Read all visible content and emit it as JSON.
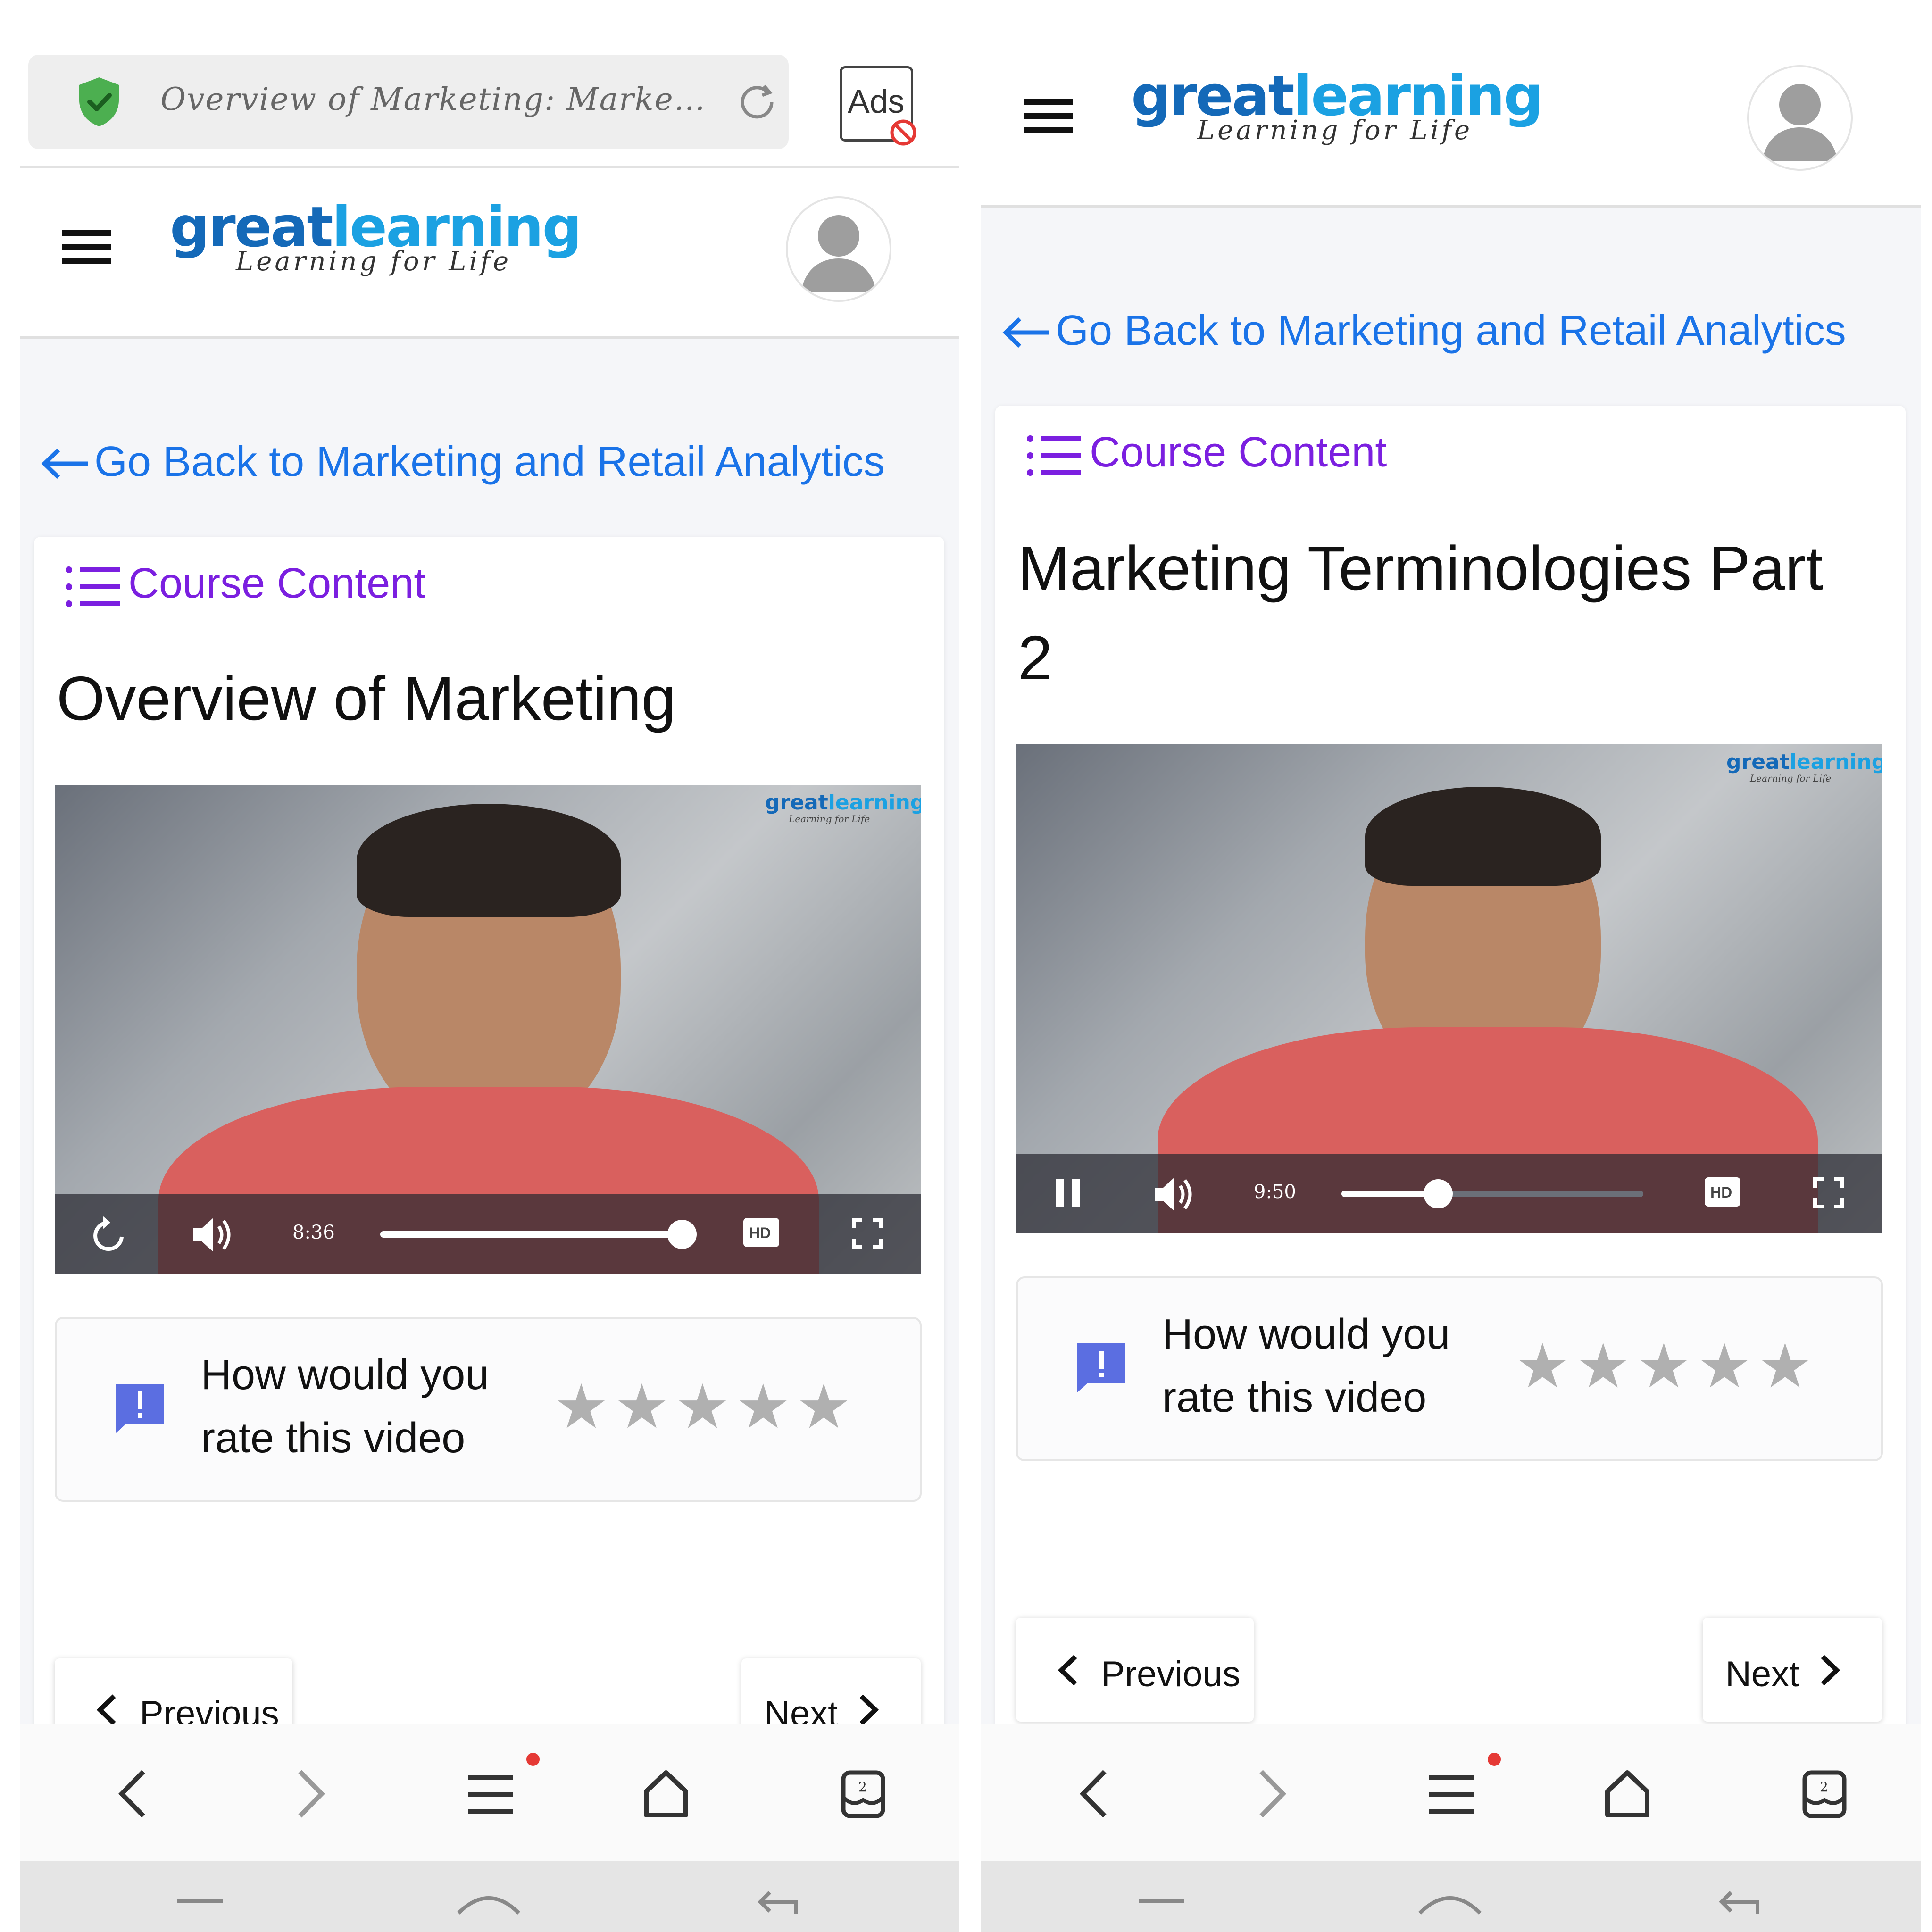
{
  "left": {
    "browser": {
      "address_text": "Overview of Marketing: Marketing an...",
      "ads_label": "Ads"
    },
    "logo": {
      "part1": "great",
      "part2": "learning",
      "tagline": "Learning for Life"
    },
    "back_link": "Go Back to Marketing and Retail Analytics",
    "course_content": "Course Content",
    "title": "Overview of Marketing",
    "video": {
      "time": "8:36",
      "progress": 1.0,
      "watermark_part1": "great",
      "watermark_part2": "learning",
      "watermark_tagline": "Learning for Life",
      "hd_label": "HD"
    },
    "rating": {
      "question": "How would you rate this video",
      "stars_total": 5
    },
    "nav": {
      "previous": "Previous",
      "next": "Next"
    },
    "bottom_tabs_count": "2"
  },
  "right": {
    "logo": {
      "part1": "great",
      "part2": "learning",
      "tagline": "Learning for Life"
    },
    "back_link": "Go Back to Marketing and Retail Analytics",
    "course_content": "Course Content",
    "title": "Marketing Terminologies Part 2",
    "video": {
      "time": "9:50",
      "progress": 0.32,
      "watermark_part1": "great",
      "watermark_part2": "learning",
      "watermark_tagline": "Learning for Life",
      "hd_label": "HD"
    },
    "rating": {
      "question": "How would you rate this video",
      "stars_total": 5
    },
    "nav": {
      "previous": "Previous",
      "next": "Next"
    },
    "bottom_tabs_count": "2"
  },
  "colors": {
    "link_blue": "#1a73e8",
    "course_purple": "#7b1fe0",
    "logo_dark_blue": "#1469b8",
    "logo_light_blue": "#1ba1e2",
    "feedback_icon": "#5b6ee1",
    "notification_dot": "#e53935"
  },
  "icons": [
    "shield-check-icon",
    "reload-icon",
    "ads-block-icon",
    "hamburger-icon",
    "avatar-icon",
    "arrow-left-icon",
    "list-icon",
    "replay-icon",
    "pause-icon",
    "volume-icon",
    "hd-icon",
    "fullscreen-icon",
    "feedback-icon",
    "star-icon",
    "chevron-left-icon",
    "chevron-right-icon",
    "browser-back-icon",
    "browser-forward-icon",
    "menu-icon",
    "home-icon",
    "tabs-icon"
  ]
}
